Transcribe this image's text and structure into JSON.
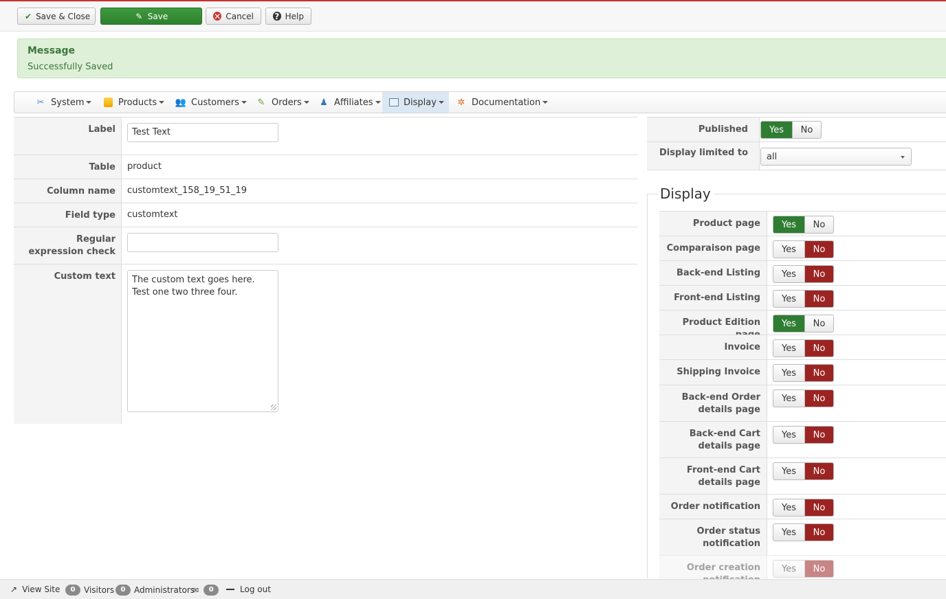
{
  "toolbar": {
    "save_close": "Save & Close",
    "save": "Save",
    "cancel": "Cancel",
    "help": "Help"
  },
  "message": {
    "title": "Message",
    "text": "Successfully Saved"
  },
  "nav": {
    "items": [
      {
        "label": "System",
        "icon": "tools-icon"
      },
      {
        "label": "Products",
        "icon": "products-icon"
      },
      {
        "label": "Customers",
        "icon": "customers-icon"
      },
      {
        "label": "Orders",
        "icon": "orders-icon"
      },
      {
        "label": "Affiliates",
        "icon": "affiliates-icon"
      },
      {
        "label": "Display",
        "icon": "display-icon",
        "active": true
      },
      {
        "label": "Documentation",
        "icon": "lifebuoy-icon"
      }
    ]
  },
  "form": {
    "label": {
      "label": "Label",
      "value": "Test Text"
    },
    "table": {
      "label": "Table",
      "value": "product"
    },
    "column_name": {
      "label": "Column name",
      "value": "customtext_158_19_51_19"
    },
    "field_type": {
      "label": "Field type",
      "value": "customtext"
    },
    "regex": {
      "label": "Regular expression check",
      "value": ""
    },
    "custom_text": {
      "label": "Custom text",
      "value": "The custom text goes here. Test one two three four."
    }
  },
  "right": {
    "published": {
      "label": "Published",
      "yes": "Yes",
      "no": "No",
      "value": "Yes"
    },
    "display_limited": {
      "label": "Display limited to",
      "value": "all"
    }
  },
  "display": {
    "legend": "Display",
    "yes_label": "Yes",
    "no_label": "No",
    "rows": [
      {
        "label": "Product page",
        "value": "Yes"
      },
      {
        "label": "Comparaison page",
        "value": "No"
      },
      {
        "label": "Back-end Listing",
        "value": "No"
      },
      {
        "label": "Front-end Listing",
        "value": "No"
      },
      {
        "label": "Product Edition page",
        "value": "Yes"
      },
      {
        "label": "Invoice",
        "value": "No"
      },
      {
        "label": "Shipping Invoice",
        "value": "No"
      },
      {
        "label": "Back-end Order details page",
        "value": "No"
      },
      {
        "label": "Back-end Cart details page",
        "value": "No"
      },
      {
        "label": "Front-end Cart details page",
        "value": "No"
      },
      {
        "label": "Order notification",
        "value": "No"
      },
      {
        "label": "Order status notification",
        "value": "No"
      },
      {
        "label": "Order creation notification",
        "value": "No"
      }
    ]
  },
  "status": {
    "view_site": "View Site",
    "visitors_count": "0",
    "visitors": "Visitors",
    "admins_count": "0",
    "admins": "Administrators",
    "messages_count": "0",
    "logout": "Log out"
  },
  "colors": {
    "accent_red": "#c9302c",
    "yes_green": "#2f7d32",
    "no_red": "#9b2423",
    "message_bg": "#dff0d8"
  }
}
